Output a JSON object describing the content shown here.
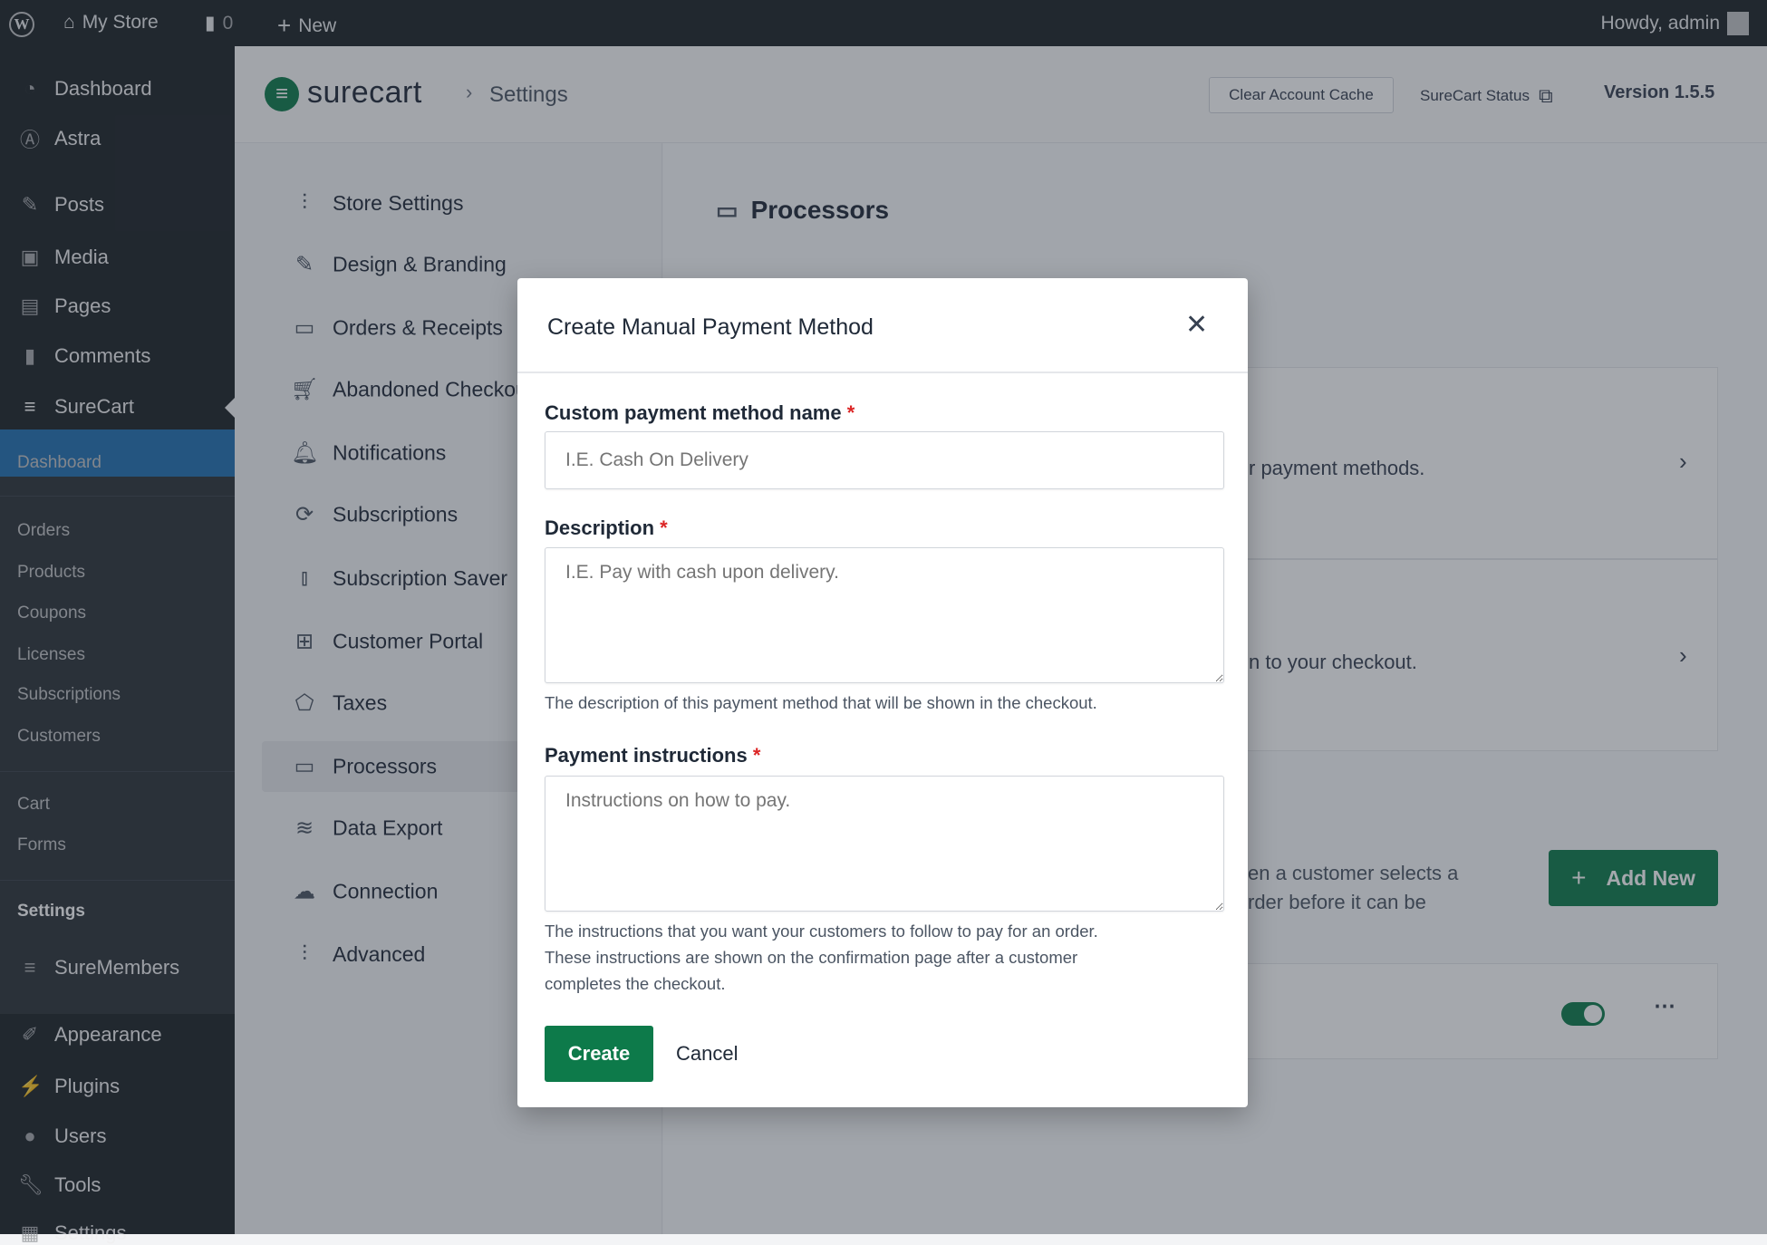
{
  "topbar": {
    "site": "My Store",
    "comments": "0",
    "new": "New",
    "howdy": "Howdy, admin"
  },
  "sidebar": {
    "items": [
      {
        "label": "Dashboard",
        "icon": "dashboard-icon"
      },
      {
        "label": "Astra",
        "icon": "astra-icon"
      },
      {
        "label": "Posts",
        "icon": "pin-icon"
      },
      {
        "label": "Media",
        "icon": "media-icon"
      },
      {
        "label": "Pages",
        "icon": "pages-icon"
      },
      {
        "label": "Comments",
        "icon": "comment-icon"
      },
      {
        "label": "SureCart",
        "icon": "surecart-icon"
      }
    ],
    "sub": [
      "Dashboard",
      "Orders",
      "Products",
      "Coupons",
      "Licenses",
      "Subscriptions",
      "Customers",
      "Cart",
      "Forms",
      "Settings"
    ],
    "items2": [
      {
        "label": "SureMembers"
      },
      {
        "label": "Appearance"
      },
      {
        "label": "Plugins"
      },
      {
        "label": "Users"
      },
      {
        "label": "Tools"
      },
      {
        "label": "Settings"
      }
    ]
  },
  "header": {
    "brand": "surecart",
    "breadcrumb": "Settings",
    "clear_cache": "Clear Account Cache",
    "status": "SureCart Status",
    "version": "Version 1.5.5"
  },
  "settings_nav": [
    "Store Settings",
    "Design & Branding",
    "Orders & Receipts",
    "Abandoned Checkout",
    "Notifications",
    "Subscriptions",
    "Subscription Saver",
    "Customer Portal",
    "Taxes",
    "Processors",
    "Data Export",
    "Connection",
    "Advanced"
  ],
  "content": {
    "title": "Processors",
    "card1_text": "r payment methods.",
    "card2_text": "n to your checkout.",
    "manual_line1": "en a customer selects a",
    "manual_line2": "rder before it can be",
    "add_new": "Add New",
    "toggle_on": true
  },
  "modal": {
    "title": "Create Manual Payment Method",
    "name_label": "Custom payment method name",
    "name_placeholder": "I.E. Cash On Delivery",
    "desc_label": "Description",
    "desc_placeholder": "I.E. Pay with cash upon delivery.",
    "desc_help": "The description of this payment method that will be shown in the checkout.",
    "instr_label": "Payment instructions",
    "instr_placeholder": "Instructions on how to pay.",
    "instr_help1": "The instructions that you want your customers to follow to pay for an order.",
    "instr_help2": "These instructions are shown on the confirmation page after a customer",
    "instr_help3": "completes the checkout.",
    "create": "Create",
    "cancel": "Cancel",
    "required": "*"
  },
  "colors": {
    "brand_green": "#0d7a4a",
    "wp_blue": "#2271b1",
    "wp_dark": "#1d2327"
  }
}
